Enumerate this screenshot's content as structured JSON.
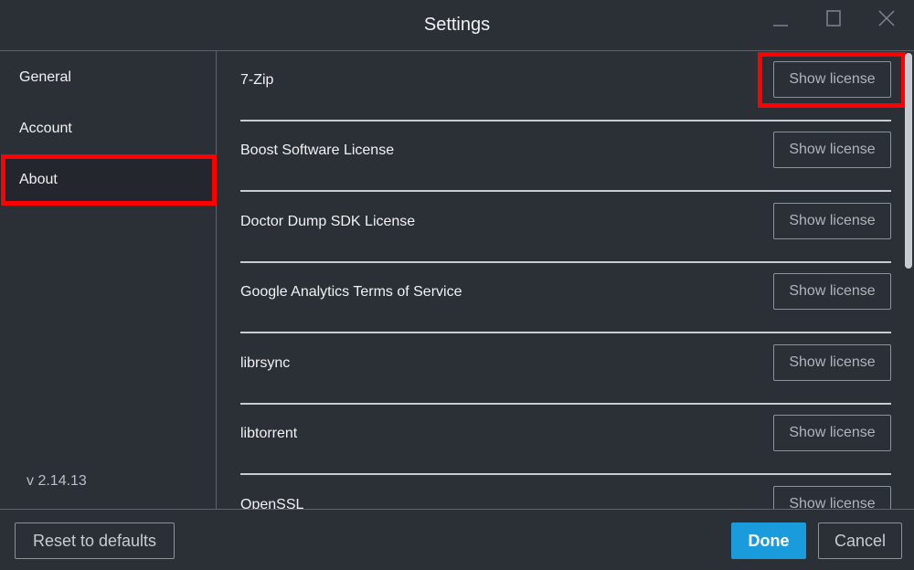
{
  "window": {
    "title": "Settings",
    "controls": [
      "minimize-icon",
      "maximize-icon",
      "close-icon"
    ]
  },
  "sidebar": {
    "items": [
      {
        "label": "General"
      },
      {
        "label": "Account"
      },
      {
        "label": "About",
        "active": true
      }
    ],
    "version": "v 2.14.13"
  },
  "licenses": {
    "button_label": "Show license",
    "items": [
      {
        "name": "7-Zip"
      },
      {
        "name": "Boost Software License"
      },
      {
        "name": "Doctor Dump SDK License"
      },
      {
        "name": "Google Analytics Terms of Service"
      },
      {
        "name": "librsync"
      },
      {
        "name": "libtorrent"
      },
      {
        "name": "OpenSSL"
      }
    ]
  },
  "footer": {
    "reset_label": "Reset to defaults",
    "done_label": "Done",
    "cancel_label": "Cancel"
  },
  "colors": {
    "background": "#2b2f36",
    "active_item": "#23262c",
    "primary": "#1a9bdc",
    "highlight": "#ff0000"
  }
}
